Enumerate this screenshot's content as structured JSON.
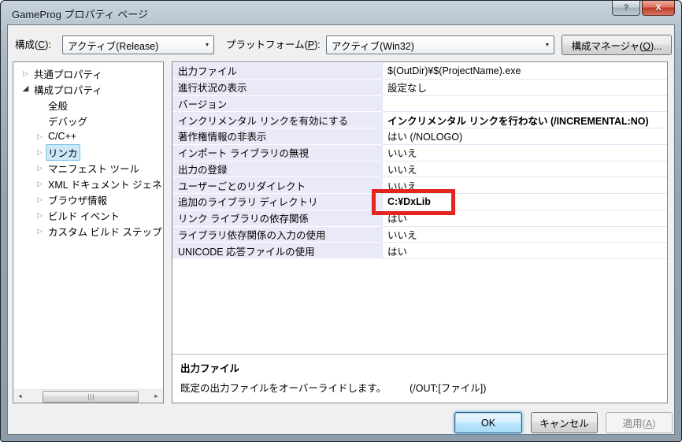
{
  "window": {
    "title": "GameProg プロパティ ページ"
  },
  "icons": {
    "help": "?",
    "close": "X",
    "dropdown": "▼",
    "tree_collapsed": "▷",
    "tree_expanded": "◢",
    "scroll_left": "◄",
    "scroll_right": "►"
  },
  "toolbar": {
    "config_label": {
      "pre": "構成(",
      "key": "C",
      "post": "):"
    },
    "config_value": "アクティブ(Release)",
    "platform_label": {
      "pre": "プラットフォーム(",
      "key": "P",
      "post": "):"
    },
    "platform_value": "アクティブ(Win32)",
    "config_manager_button": {
      "pre": "構成マネージャ(",
      "key": "O",
      "post": ")..."
    }
  },
  "tree": {
    "items": [
      {
        "label": "共通プロパティ",
        "level": 0,
        "state": "collapsed",
        "selected": false
      },
      {
        "label": "構成プロパティ",
        "level": 0,
        "state": "expanded",
        "selected": false
      },
      {
        "label": "全般",
        "level": 1,
        "state": "none",
        "selected": false
      },
      {
        "label": "デバッグ",
        "level": 1,
        "state": "none",
        "selected": false
      },
      {
        "label": "C/C++",
        "level": 1,
        "state": "collapsed",
        "selected": false
      },
      {
        "label": "リンカ",
        "level": 1,
        "state": "collapsed",
        "selected": true
      },
      {
        "label": "マニフェスト ツール",
        "level": 1,
        "state": "collapsed",
        "selected": false
      },
      {
        "label": "XML ドキュメント ジェネ",
        "level": 1,
        "state": "collapsed",
        "selected": false
      },
      {
        "label": "ブラウザ情報",
        "level": 1,
        "state": "collapsed",
        "selected": false
      },
      {
        "label": "ビルド イベント",
        "level": 1,
        "state": "collapsed",
        "selected": false
      },
      {
        "label": "カスタム ビルド ステップ",
        "level": 1,
        "state": "collapsed",
        "selected": false
      }
    ]
  },
  "grid": {
    "rows": [
      {
        "label": "出力ファイル",
        "value": "$(OutDir)¥$(ProjectName).exe",
        "bold": false
      },
      {
        "label": "進行状況の表示",
        "value": "設定なし",
        "bold": false
      },
      {
        "label": "バージョン",
        "value": "",
        "bold": false
      },
      {
        "label": "インクリメンタル リンクを有効にする",
        "value": "インクリメンタル リンクを行わない (/INCREMENTAL:NO)",
        "bold": true
      },
      {
        "label": "著作権情報の非表示",
        "value": "はい (/NOLOGO)",
        "bold": false
      },
      {
        "label": "インポート ライブラリの無視",
        "value": "いいえ",
        "bold": false
      },
      {
        "label": "出力の登録",
        "value": "いいえ",
        "bold": false
      },
      {
        "label": "ユーザーごとのリダイレクト",
        "value": "いいえ",
        "bold": false
      },
      {
        "label": "追加のライブラリ ディレクトリ",
        "value": "C:¥DxLib",
        "bold": true
      },
      {
        "label": "リンク ライブラリの依存関係",
        "value": "はい",
        "bold": false
      },
      {
        "label": "ライブラリ依存関係の入力の使用",
        "value": "いいえ",
        "bold": false
      },
      {
        "label": "UNICODE 応答ファイルの使用",
        "value": "はい",
        "bold": false
      }
    ]
  },
  "description": {
    "title": "出力ファイル",
    "text": "既定の出力ファイルをオーバーライドします。",
    "switch": "(/OUT:[ファイル])"
  },
  "footer": {
    "ok_label": "OK",
    "cancel_label": "キャンセル",
    "apply_label": {
      "pre": "適用(",
      "key": "A",
      "post": ")"
    }
  },
  "annotation": {
    "color": "#e2261f"
  }
}
